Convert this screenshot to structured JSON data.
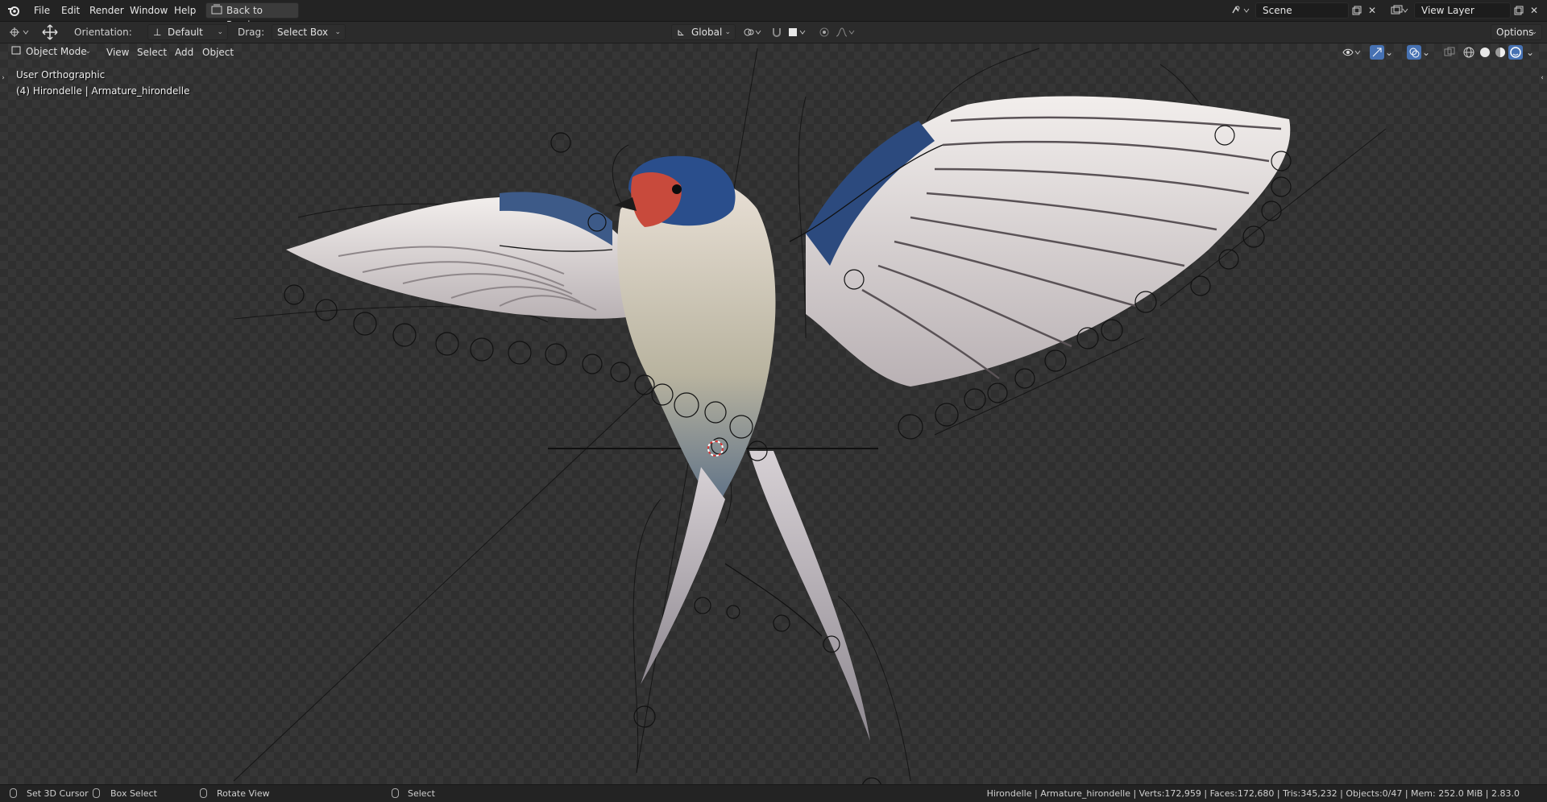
{
  "topbar": {
    "menus": [
      "File",
      "Edit",
      "Render",
      "Window",
      "Help"
    ],
    "back_button": "Back to Previous",
    "scene_label": "Scene",
    "view_layer_label": "View Layer"
  },
  "toolbar": {
    "orientation_label": "Orientation:",
    "orientation_value": "Default",
    "drag_label": "Drag:",
    "drag_value": "Select Box",
    "transform_orientation": "Global",
    "options_label": "Options"
  },
  "viewport": {
    "mode": "Object Mode",
    "menus": [
      "View",
      "Select",
      "Add",
      "Object"
    ],
    "view_name": "User Orthographic",
    "object_info": "(4) Hirondelle | Armature_hirondelle"
  },
  "statusbar": {
    "set_cursor": "Set 3D Cursor",
    "box_select": "Box Select",
    "rotate_view": "Rotate View",
    "select": "Select",
    "stats": "Hirondelle | Armature_hirondelle | Verts:172,959 | Faces:172,680 | Tris:345,232 | Objects:0/47 | Mem: 252.0 MiB | 2.83.0"
  },
  "colors": {
    "accent": "#4772b3",
    "header_bg": "#232323",
    "toolbar_bg": "#2b2b2b",
    "bird_head": "#2a4e8c",
    "bird_throat": "#c84a3c"
  }
}
